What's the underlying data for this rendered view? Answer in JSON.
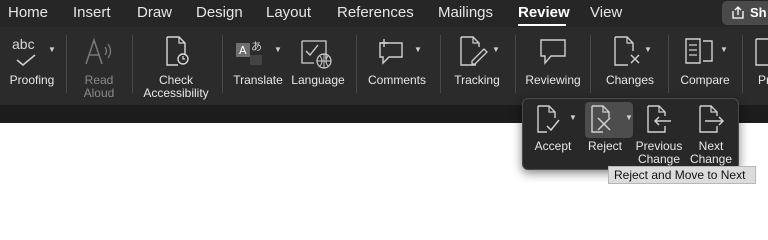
{
  "tabs": [
    {
      "label": "Home",
      "active": false
    },
    {
      "label": "Insert",
      "active": false
    },
    {
      "label": "Draw",
      "active": false
    },
    {
      "label": "Design",
      "active": false
    },
    {
      "label": "Layout",
      "active": false
    },
    {
      "label": "References",
      "active": false
    },
    {
      "label": "Mailings",
      "active": false
    },
    {
      "label": "Review",
      "active": true
    },
    {
      "label": "View",
      "active": false
    }
  ],
  "share": {
    "label": "Sh",
    "icon": "share-icon"
  },
  "ribbon": {
    "proofing": {
      "icon_text": "abc",
      "label": "Proofing"
    },
    "read_aloud": {
      "label_1": "Read",
      "label_2": "Aloud",
      "enabled": false
    },
    "check_accessibility": {
      "label_1": "Check",
      "label_2": "Accessibility"
    },
    "translate": {
      "label": "Translate"
    },
    "language": {
      "label": "Language"
    },
    "comments": {
      "label": "Comments"
    },
    "tracking": {
      "label": "Tracking"
    },
    "reviewing": {
      "label": "Reviewing"
    },
    "changes": {
      "label": "Changes"
    },
    "compare": {
      "label": "Compare"
    },
    "protect": {
      "label": "Pr"
    }
  },
  "changes_menu": {
    "accept": {
      "label": "Accept"
    },
    "reject": {
      "label": "Reject"
    },
    "previous_change": {
      "label_1": "Previous",
      "label_2": "Change"
    },
    "next_change": {
      "label_1": "Next",
      "label_2": "Change"
    }
  },
  "tooltip": {
    "text": "Reject and Move to Next"
  },
  "colors": {
    "tab_bar": "#262626",
    "ribbon": "#2b2b2b",
    "popup": "#282828",
    "tooltip": "#dcdcdc",
    "text": "#e8e8e8"
  }
}
